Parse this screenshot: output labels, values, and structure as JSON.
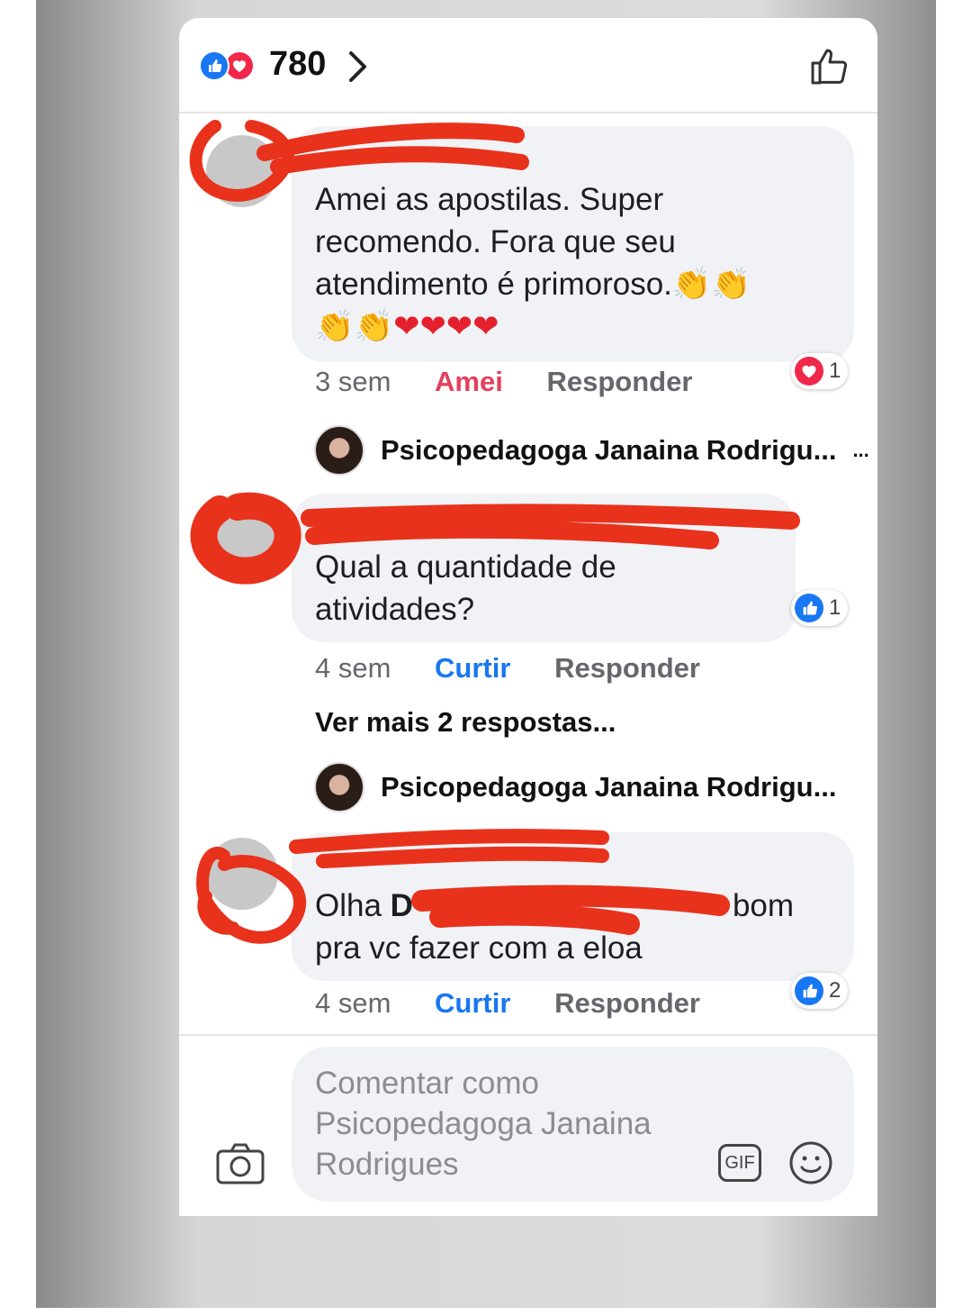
{
  "header": {
    "reaction_count": "780"
  },
  "comments": [
    {
      "text_line1": "Amei as apostilas. Super",
      "text_line2": "recomendo. Fora que seu",
      "text_line3": "atendimento é primoroso.",
      "emoji_trail": "👏👏",
      "emoji_line": "👏👏❤❤❤❤",
      "time": "3 sem",
      "react_label": "Amei",
      "reply_label": "Responder",
      "reaction_badge_count": "1",
      "reaction_badge_type": "love"
    },
    {
      "text_line1": "Qual a quantidade de",
      "text_line2": "atividades?",
      "time": "4 sem",
      "react_label": "Curtir",
      "reply_label": "Responder",
      "reaction_badge_count": "1",
      "reaction_badge_type": "like",
      "more_replies": "Ver mais 2 respostas..."
    },
    {
      "text_prefix": "Olha ",
      "text_bold": "D",
      "text_suffix": "bom",
      "text_line2": "pra vc fazer com a eloa",
      "time": "4 sem",
      "react_label": "Curtir",
      "reply_label": "Responder",
      "reaction_badge_count": "2",
      "reaction_badge_type": "like"
    }
  ],
  "replies": [
    {
      "author": "Psicopedagoga Janaina Rodrigu...",
      "extra": "..."
    },
    {
      "author": "Psicopedagoga Janaina Rodrigu..."
    }
  ],
  "composer": {
    "placeholder_line1": "Comentar como",
    "placeholder_line2": "Psicopedagoga Janaina",
    "placeholder_line3": "Rodrigues",
    "gif_label": "GIF"
  },
  "colors": {
    "like": "#1877f2",
    "love": "#f0284a",
    "scribble": "#e8321c"
  },
  "icons": [
    "like-icon",
    "love-icon",
    "chevron-right-icon",
    "thumbs-up-icon",
    "camera-icon",
    "gif-icon",
    "emoji-icon"
  ]
}
